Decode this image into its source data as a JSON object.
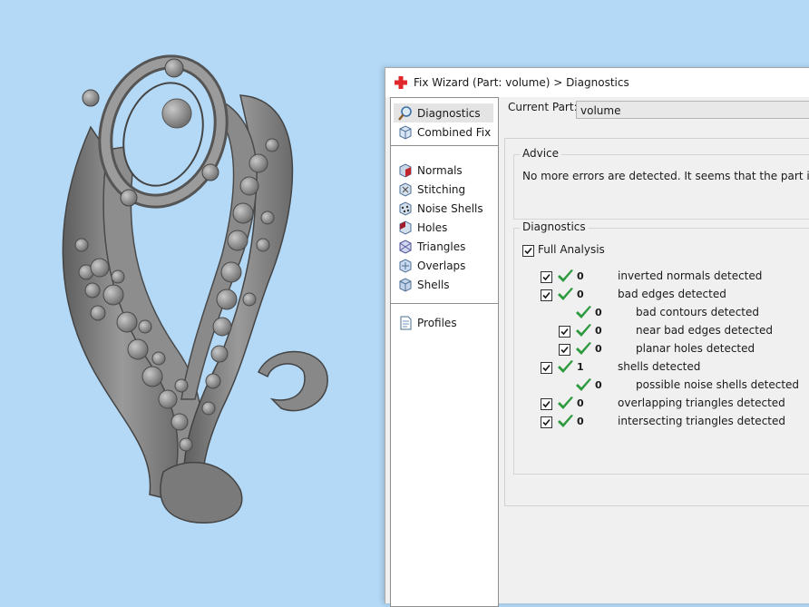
{
  "dialog": {
    "title": "Fix Wizard (Part: volume) > Diagnostics"
  },
  "nav": {
    "items": [
      {
        "label": "Diagnostics",
        "icon": "magnifier-icon"
      },
      {
        "label": "Combined Fix",
        "icon": "cube-icon"
      },
      {
        "label": "Normals",
        "icon": "normals-icon"
      },
      {
        "label": "Stitching",
        "icon": "stitching-icon"
      },
      {
        "label": "Noise Shells",
        "icon": "noise-shells-icon"
      },
      {
        "label": "Holes",
        "icon": "holes-icon"
      },
      {
        "label": "Triangles",
        "icon": "triangles-icon"
      },
      {
        "label": "Overlaps",
        "icon": "overlaps-icon"
      },
      {
        "label": "Shells",
        "icon": "shells-icon"
      },
      {
        "label": "Profiles",
        "icon": "document-icon"
      }
    ]
  },
  "main": {
    "current_part_label": "Current Part:",
    "current_part_value": "volume",
    "advice_title": "Advice",
    "advice_text": "No more errors are detected. It seems that the part is ok.",
    "diagnostics_title": "Diagnostics",
    "full_analysis_label": "Full Analysis"
  },
  "diagnostics": [
    {
      "count": "0",
      "label": "inverted normals detected"
    },
    {
      "count": "0",
      "label": "bad edges detected"
    },
    {
      "count": "0",
      "label": "bad contours detected"
    },
    {
      "count": "0",
      "label": "near bad edges detected"
    },
    {
      "count": "0",
      "label": "planar holes detected"
    },
    {
      "count": "1",
      "label": "shells detected"
    },
    {
      "count": "0",
      "label": "possible noise shells detected"
    },
    {
      "count": "0",
      "label": "overlapping triangles detected"
    },
    {
      "count": "0",
      "label": "intersecting triangles detected"
    }
  ],
  "colors": {
    "viewport_bg": "#b4d9f6",
    "check_green": "#2e9a3e",
    "title_cross": "#e0272b"
  }
}
